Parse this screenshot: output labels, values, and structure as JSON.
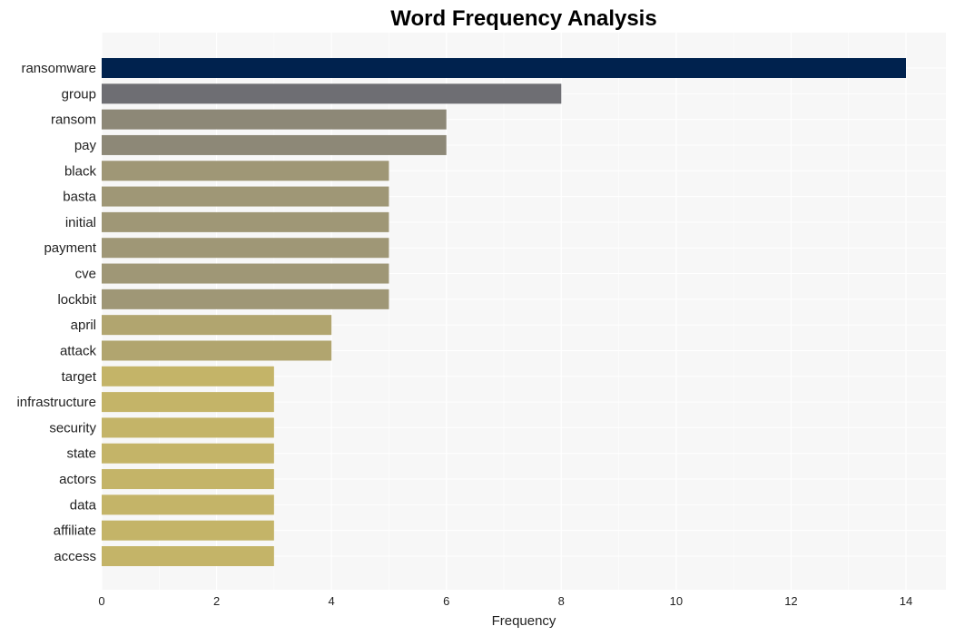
{
  "chart_data": {
    "type": "bar",
    "orientation": "horizontal",
    "title": "Word Frequency Analysis",
    "xlabel": "Frequency",
    "ylabel": "",
    "xlim": [
      0,
      14.7
    ],
    "xticks": [
      0,
      2,
      4,
      6,
      8,
      10,
      12,
      14
    ],
    "grid": true,
    "categories": [
      "ransomware",
      "group",
      "ransom",
      "pay",
      "black",
      "basta",
      "initial",
      "payment",
      "cve",
      "lockbit",
      "april",
      "attack",
      "target",
      "infrastructure",
      "security",
      "state",
      "actors",
      "data",
      "affiliate",
      "access"
    ],
    "values": [
      14,
      8,
      6,
      6,
      5,
      5,
      5,
      5,
      5,
      5,
      4,
      4,
      3,
      3,
      3,
      3,
      3,
      3,
      3,
      3
    ],
    "colors": {
      "14": "#00224e",
      "8": "#6e6e73",
      "6": "#8d8877",
      "5": "#9f9776",
      "4": "#b1a56f",
      "3": "#c4b468"
    },
    "background": "#f7f7f7",
    "gridline_color": "#ffffff"
  }
}
